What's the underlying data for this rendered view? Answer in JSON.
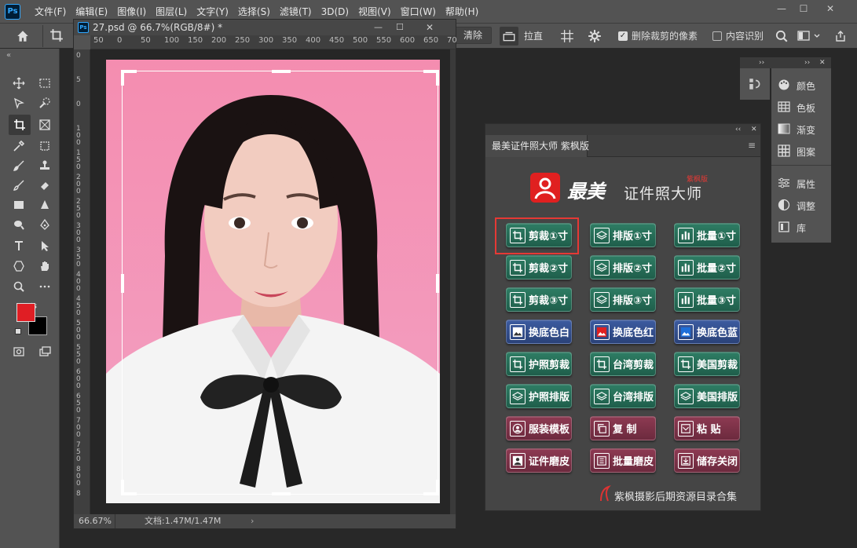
{
  "app": {
    "logo": "Ps"
  },
  "menu": [
    "文件(F)",
    "编辑(E)",
    "图像(I)",
    "图层(L)",
    "文字(Y)",
    "选择(S)",
    "滤镜(T)",
    "3D(D)",
    "视图(V)",
    "窗口(W)",
    "帮助(H)"
  ],
  "window_controls": {
    "minimize": "—",
    "restore": "☐",
    "close": "✕"
  },
  "options": {
    "clear_label": "清除",
    "straighten_label": "拉直",
    "delete_cropped_label": "删除裁剪的像素",
    "delete_cropped_checked": true,
    "content_aware_label": "内容识别",
    "content_aware_checked": false
  },
  "document": {
    "title": "27.psd @ 66.7%(RGB/8#) *",
    "zoom": "66.67%",
    "doc_size": "文档:1.47M/1.47M",
    "ruler_top": [
      "50",
      "0",
      "50",
      "100",
      "150",
      "200",
      "250",
      "300",
      "350",
      "400",
      "450",
      "500",
      "550",
      "600",
      "650",
      "70"
    ],
    "ruler_left": [
      "0",
      "5",
      "0",
      "1 0 0",
      "1 5 0",
      "2 0 0",
      "2 5 0",
      "3 0 0",
      "3 5 0",
      "4 0 0",
      "4 5 0",
      "5 0 0",
      "5 5 0",
      "6 0 0",
      "6 5 0",
      "7 0 0",
      "7 5 0",
      "8 0 0",
      "8"
    ]
  },
  "colors": {
    "foreground": "#e01e24",
    "background": "#000000",
    "accent_red": "#e53935",
    "btn_green": "#2e7d64",
    "btn_blue": "#3c5ba0",
    "btn_maroon": "#8d3a52"
  },
  "plugin": {
    "tab": "最美证件照大师 紫枫版",
    "logo_script": "最美",
    "logo_text": "证件照大师",
    "logo_badge": "紫枫版",
    "buttons": [
      {
        "label": "剪裁①寸",
        "icon": "crop-icon",
        "style": "green"
      },
      {
        "label": "排版①寸",
        "icon": "layers-icon",
        "style": "green"
      },
      {
        "label": "批量①寸",
        "icon": "bars-icon",
        "style": "green"
      },
      {
        "label": "剪裁②寸",
        "icon": "crop-icon",
        "style": "green"
      },
      {
        "label": "排版②寸",
        "icon": "layers-icon",
        "style": "green"
      },
      {
        "label": "批量②寸",
        "icon": "bars-icon",
        "style": "green"
      },
      {
        "label": "剪裁③寸",
        "icon": "crop-icon",
        "style": "green"
      },
      {
        "label": "排版③寸",
        "icon": "layers-icon",
        "style": "green"
      },
      {
        "label": "批量③寸",
        "icon": "bars-icon",
        "style": "green"
      },
      {
        "label": "换底色白",
        "icon": "image-white-icon",
        "style": "blue"
      },
      {
        "label": "换底色红",
        "icon": "image-red-icon",
        "style": "blue"
      },
      {
        "label": "换底色蓝",
        "icon": "image-blue-icon",
        "style": "blue"
      },
      {
        "label": "护照剪裁",
        "icon": "crop-icon",
        "style": "green"
      },
      {
        "label": "台湾剪裁",
        "icon": "crop-icon",
        "style": "green"
      },
      {
        "label": "美国剪裁",
        "icon": "crop-icon",
        "style": "green"
      },
      {
        "label": "护照排版",
        "icon": "layers-icon",
        "style": "green"
      },
      {
        "label": "台湾排版",
        "icon": "layers-icon",
        "style": "green"
      },
      {
        "label": "美国排版",
        "icon": "layers-icon",
        "style": "green"
      },
      {
        "label": "服装模板",
        "icon": "person-icon",
        "style": "maroon"
      },
      {
        "label": "复 制",
        "icon": "copy-icon",
        "style": "maroon"
      },
      {
        "label": "粘 贴",
        "icon": "paste-icon",
        "style": "maroon"
      },
      {
        "label": "证件磨皮",
        "icon": "id-person-icon",
        "style": "maroon"
      },
      {
        "label": "批量磨皮",
        "icon": "list-icon",
        "style": "maroon"
      },
      {
        "label": "储存关闭",
        "icon": "save-icon",
        "style": "maroon"
      }
    ],
    "footer": "紫枫摄影后期资源目录合集"
  },
  "right_panel": {
    "items": [
      "颜色",
      "色板",
      "渐变",
      "图案",
      "属性",
      "调整",
      "库"
    ]
  }
}
